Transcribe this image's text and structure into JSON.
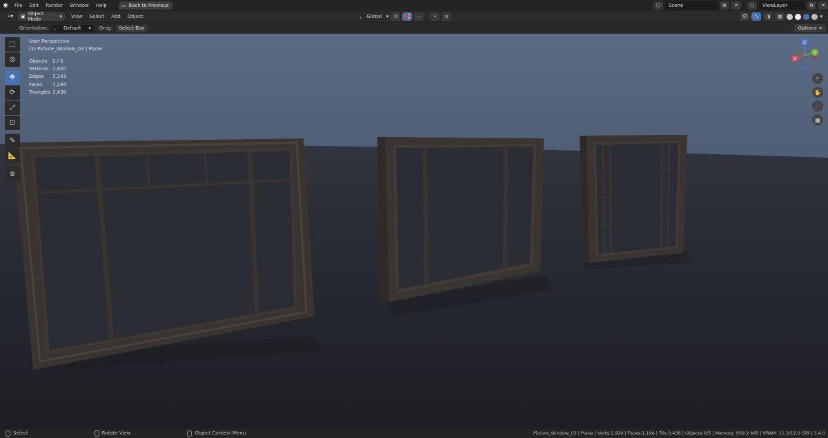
{
  "topbar": {
    "menus": [
      "File",
      "Edit",
      "Render",
      "Window",
      "Help"
    ],
    "back_button": "Back to Previous",
    "scene": "Scene",
    "view_layer": "ViewLayer"
  },
  "viewport_header": {
    "mode": "Object Mode",
    "menus": [
      "View",
      "Select",
      "Add",
      "Object"
    ],
    "transform_orientation": "Global"
  },
  "tool_settings": {
    "orientation_label": "Orientation:",
    "orientation_value": "Default",
    "drag_label": "Drag:",
    "drag_value": "Select Box",
    "options": "Options"
  },
  "overlay": {
    "view_name": "User Perspective",
    "object_name": "(1) Picture_Window_03 | Plane"
  },
  "stats": [
    {
      "label": "Objects",
      "value": "0 / 5"
    },
    {
      "label": "Vertices",
      "value": "1,920"
    },
    {
      "label": "Edges",
      "value": "3,143"
    },
    {
      "label": "Faces",
      "value": "1,194"
    },
    {
      "label": "Triangles",
      "value": "3,438"
    }
  ],
  "gizmo": {
    "x": "X",
    "y": "Y",
    "z": "Z"
  },
  "statusbar": {
    "select": "Select",
    "rotate": "Rotate View",
    "context_menu": "Object Context Menu",
    "info": "Picture_Window_03 | Plane | Verts:1,920 | Faces:1,194 | Tris:3,438 | Objects:0/5 | Memory: 959.2 MiB | VRAM: 11.3/12.0 GiB | 3.4.0"
  },
  "colors": {
    "accent": "#4772b3",
    "frame": "#3a3431",
    "sky_top": "#5a6a83",
    "sky_bottom": "#3b4654",
    "floor": "#25272d"
  },
  "icons": {
    "logo": "blender-logo-icon",
    "tools": [
      "select-box-icon",
      "cursor-icon",
      "move-icon",
      "rotate-icon",
      "scale-icon",
      "transform-icon",
      "annotate-icon",
      "measure-icon",
      "add-cube-icon"
    ],
    "nav": [
      "zoom-icon",
      "hand-pan-icon",
      "camera-icon",
      "grid-icon"
    ]
  }
}
